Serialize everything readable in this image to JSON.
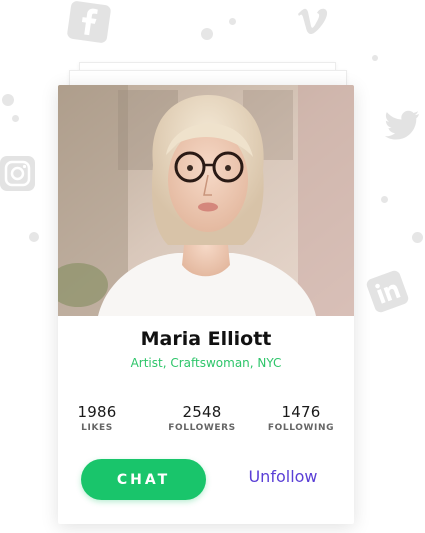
{
  "profile": {
    "name": "Maria Elliott",
    "role": "Artist, Craftswoman, NYC"
  },
  "stats": [
    {
      "value": "1986",
      "label": "LIKES"
    },
    {
      "value": "2548",
      "label": "FOLLOWERS"
    },
    {
      "value": "1476",
      "label": "FOLLOWING"
    }
  ],
  "actions": {
    "chat_label": "CHAT",
    "unfollow_label": "Unfollow"
  },
  "colors": {
    "accent_green": "#19c56b",
    "role_green": "#2ec56a",
    "link_purple": "#5a3fd6",
    "deco_gray": "#e3e3e3"
  },
  "icons": [
    "facebook-icon",
    "vimeo-icon",
    "twitter-icon",
    "instagram-icon",
    "linkedin-icon"
  ]
}
